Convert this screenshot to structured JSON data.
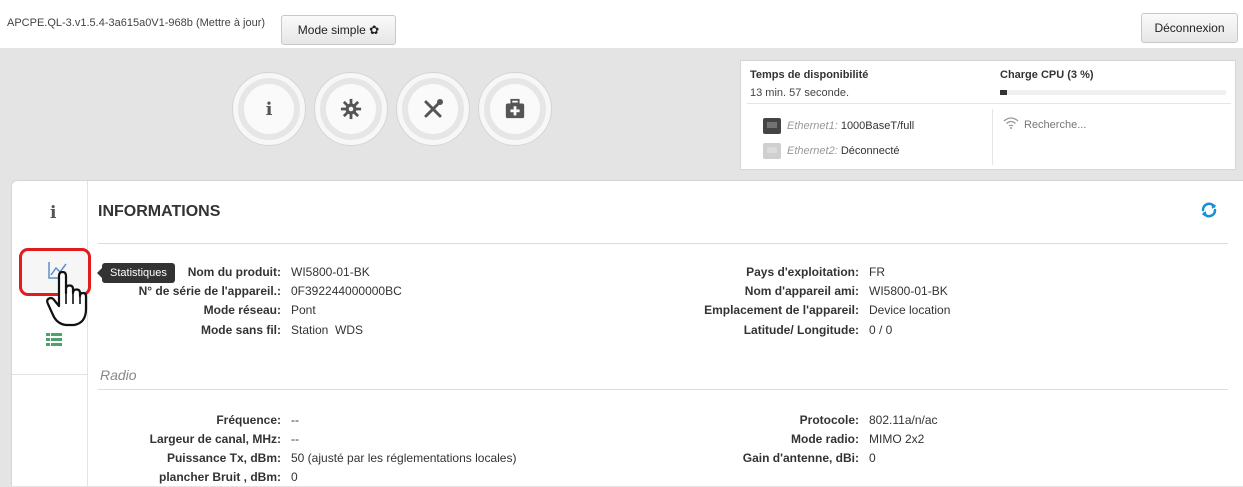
{
  "topbar": {
    "firmware": "APCPE.QL-3.v1.5.4-3a615a0V1-968b (Mettre à jour)",
    "mode_button": "Mode simple",
    "logout_button": "Déconnexion"
  },
  "nav_circles": [
    {
      "name": "info-icon",
      "glyph": "i"
    },
    {
      "name": "gear-icon",
      "glyph": "gear"
    },
    {
      "name": "tools-icon",
      "glyph": "tools"
    },
    {
      "name": "medkit-icon",
      "glyph": "medkit"
    }
  ],
  "status": {
    "uptime_label": "Temps de disponibilité",
    "uptime_value": "13 min. 57 seconde.",
    "cpu_label": "Charge CPU (3 %)",
    "cpu_fraction": 0.03,
    "eth1_name": "Ethernet1:",
    "eth1_value": " 1000BaseT/full",
    "eth2_name": "Ethernet2:",
    "eth2_value": " Déconnecté",
    "wifi_text": "Recherche..."
  },
  "card": {
    "title": "INFORMATIONS",
    "tooltip": "Statistiques",
    "radio_section": "Radio"
  },
  "info_left": [
    {
      "label": "Nom du produit:",
      "value": "WI5800-01-BK"
    },
    {
      "label": "N° de série de l'appareil.:",
      "value": "0F392244000000BC"
    },
    {
      "label": "Mode réseau:",
      "value": "Pont"
    },
    {
      "label": "Mode sans fil:",
      "value": "Station  WDS"
    }
  ],
  "info_right": [
    {
      "label": "Pays d'exploitation:",
      "value": "FR"
    },
    {
      "label": "Nom d'appareil ami:",
      "value": "WI5800-01-BK"
    },
    {
      "label": "Emplacement de l'appareil:",
      "value": "Device location"
    },
    {
      "label": "Latitude/ Longitude:",
      "value": "0 / 0"
    }
  ],
  "radio_left": [
    {
      "label": "Fréquence:",
      "value": "--"
    },
    {
      "label": "Largeur de canal, MHz:",
      "value": "--"
    },
    {
      "label": "Puissance Tx, dBm:",
      "value": "50 (ajusté par les réglementations locales)"
    },
    {
      "label": "plancher Bruit , dBm:",
      "value": "0"
    }
  ],
  "radio_right": [
    {
      "label": "Protocole:",
      "value": "802.11a/n/ac"
    },
    {
      "label": "Mode radio:",
      "value": "MIMO 2x2"
    },
    {
      "label": "Gain d'antenne, dBi:",
      "value": "0"
    }
  ]
}
